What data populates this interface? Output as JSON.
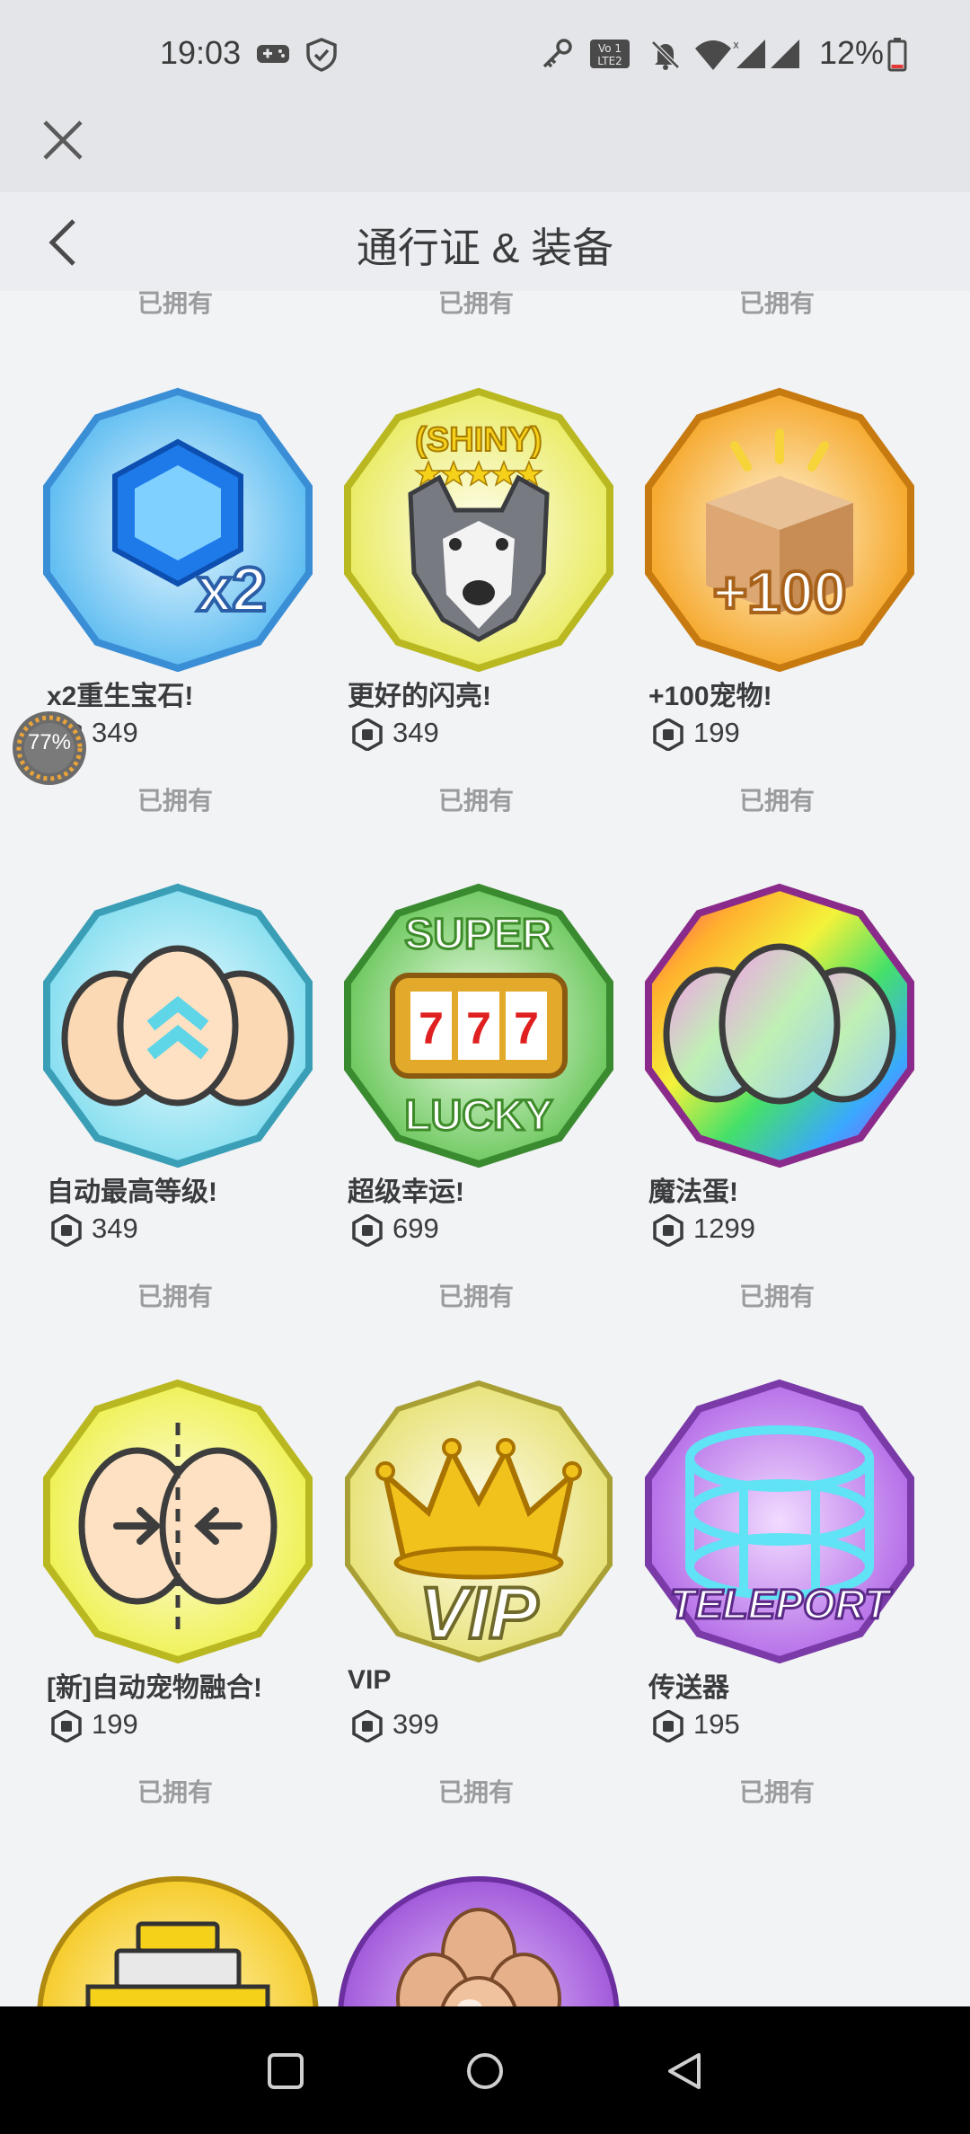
{
  "status_bar": {
    "time": "19:03",
    "battery": "12%",
    "icons": [
      "gamepad-icon",
      "shield-icon",
      "key-icon",
      "volte-icon",
      "bell-off-icon",
      "wifi-icon",
      "signal-icon",
      "signal-icon",
      "battery-icon"
    ]
  },
  "header": {
    "title": "通行证 & 装备"
  },
  "owned_label": "已拥有",
  "items": [
    {
      "name": "x2重生宝石!",
      "price": "349",
      "art": "gem-x2"
    },
    {
      "name": "更好的闪亮!",
      "price": "349",
      "art": "shiny-dog"
    },
    {
      "name": "+100宠物!",
      "price": "199",
      "art": "box-plus100"
    },
    {
      "name": "自动最高等级!",
      "price": "349",
      "art": "eggs-up"
    },
    {
      "name": "超级幸运!",
      "price": "699",
      "art": "super-lucky"
    },
    {
      "name": "魔法蛋!",
      "price": "1299",
      "art": "rainbow-eggs"
    },
    {
      "name": "[新]自动宠物融合!",
      "price": "199",
      "art": "egg-fusion"
    },
    {
      "name": "VIP",
      "price": "399",
      "art": "vip-crown"
    },
    {
      "name": "传送器",
      "price": "195",
      "art": "teleport"
    }
  ],
  "art_text": {
    "x2": "x2",
    "shiny": "(SHINY)",
    "plus100": "+100",
    "super": "SUPER",
    "lucky": "LUCKY",
    "sevens": "7",
    "vip": "VIP",
    "teleport": "TELEPORT"
  },
  "floating_badge": {
    "text": "77%"
  },
  "colors": {
    "background": "#f2f3f5",
    "header": "#ebedf0",
    "owned_text": "#9a9c9e",
    "nav_bar": "#000000"
  }
}
